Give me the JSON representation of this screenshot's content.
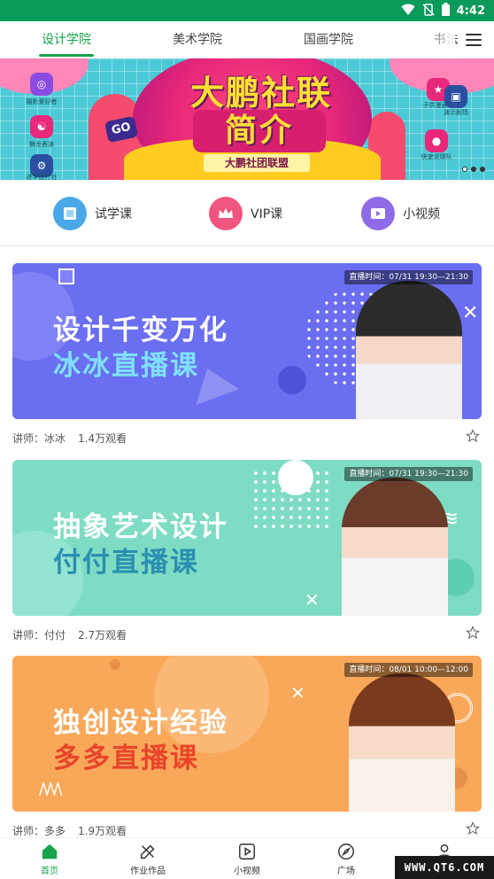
{
  "status_bar": {
    "time": "4:42"
  },
  "top_tabs": [
    {
      "label": "设计学院",
      "active": true
    },
    {
      "label": "美术学院",
      "active": false
    },
    {
      "label": "国画学院",
      "active": false
    },
    {
      "label": "书法",
      "active": false
    }
  ],
  "banner": {
    "title_line1": "大鹏社联",
    "title_line2": "简介",
    "subtitle": "大鹏社团联盟",
    "badge": "GO",
    "icon_labels": [
      "摄影爱好者",
      "舞龙表演",
      "进学旅行社",
      "子供漫画社",
      "演示剧场",
      "快速说球队"
    ],
    "slide_count": 3,
    "active_slide": 1
  },
  "categories": [
    {
      "label": "试学课",
      "icon": "book-icon",
      "color": "#4aa8e8"
    },
    {
      "label": "VIP课",
      "icon": "crown-icon",
      "color": "#f0557f"
    },
    {
      "label": "小视频",
      "icon": "video-icon",
      "color": "#8f6be8"
    }
  ],
  "courses": [
    {
      "title_line1": "设计千变万化",
      "title_line2": "冰冰直播课",
      "time_tag": "直播时间：07/31 19:30—21:30",
      "teacher": "讲师：冰冰",
      "views": "1.4万观看",
      "bg_color": "#6a6ef0",
      "title2_color": "#7fe0ff"
    },
    {
      "title_line1": "抽象艺术设计",
      "title_line2": "付付直播课",
      "time_tag": "直播时间：07/31 19:30—21:30",
      "teacher": "讲师：付付",
      "views": "2.7万观看",
      "bg_color": "#7fdcc4",
      "title2_color": "#2a8fb0"
    },
    {
      "title_line1": "独创设计经验",
      "title_line2": "多多直播课",
      "time_tag": "直播时间：08/01 10:00—12:00",
      "teacher": "讲师：多多",
      "views": "1.9万观看",
      "bg_color": "#f9a85a",
      "title2_color": "#e8452a"
    }
  ],
  "bottom_nav": [
    {
      "label": "首页",
      "icon": "home-icon",
      "active": true
    },
    {
      "label": "作业作品",
      "icon": "pencil-ruler-icon",
      "active": false
    },
    {
      "label": "小视频",
      "icon": "play-square-icon",
      "active": false
    },
    {
      "label": "广场",
      "icon": "compass-icon",
      "active": false
    },
    {
      "label": "我的",
      "icon": "user-icon",
      "active": false
    }
  ],
  "watermark": "WWW.QT6.COM",
  "colors": {
    "accent": "#17a34a",
    "status_bar": "#0a9a5a"
  }
}
